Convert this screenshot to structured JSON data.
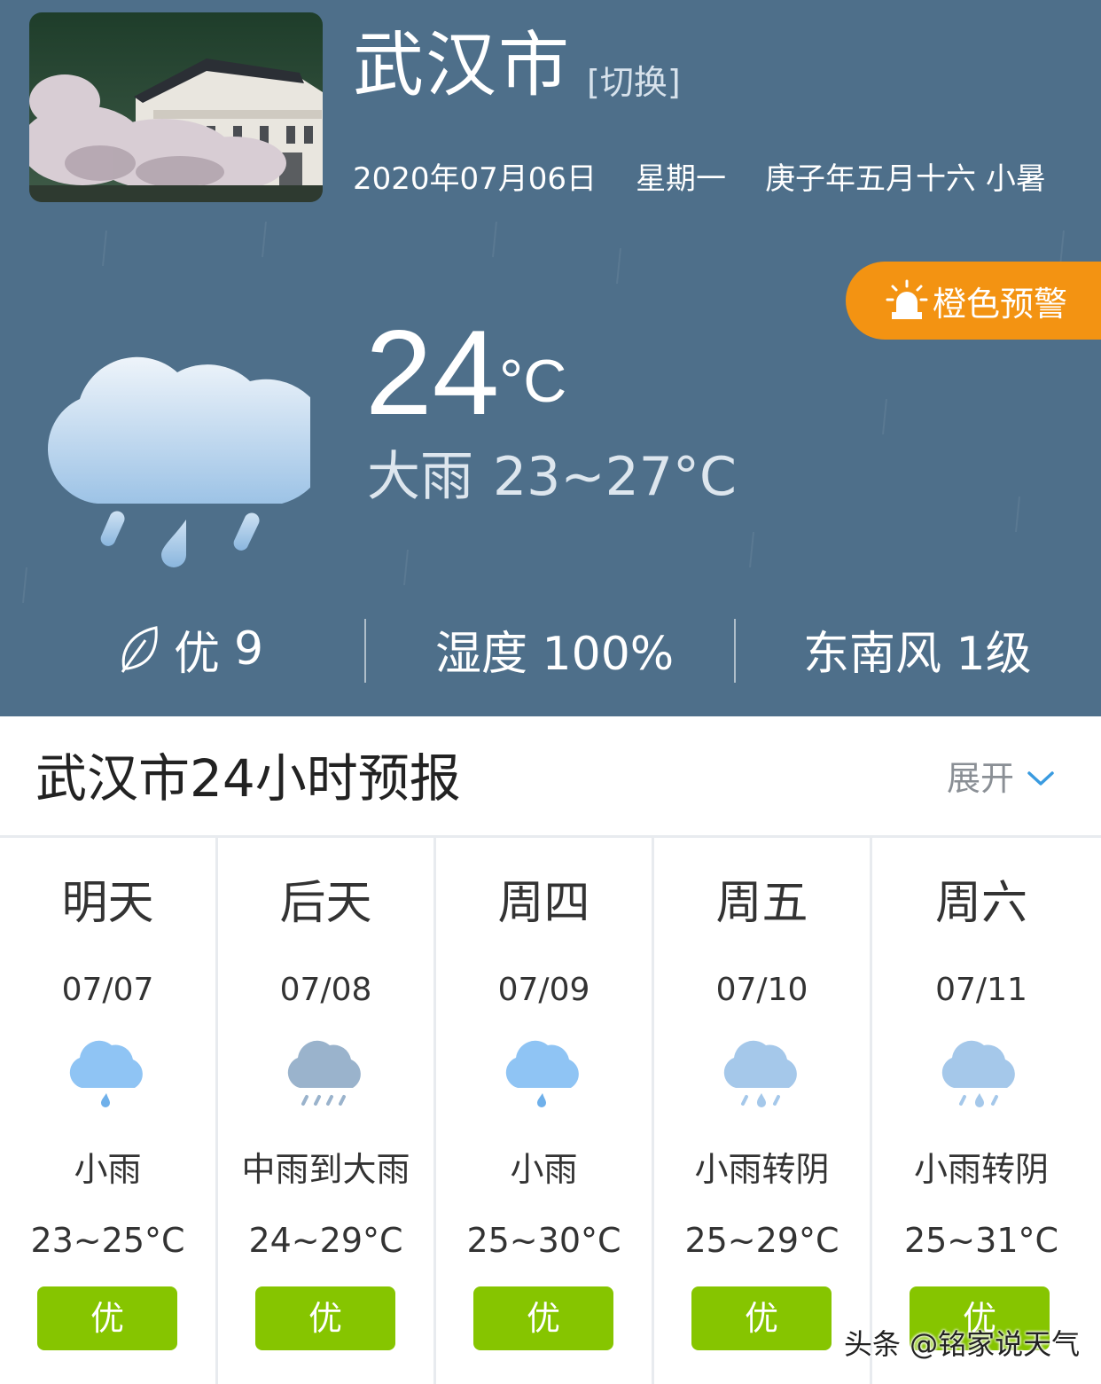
{
  "header": {
    "city": "武汉市",
    "switch_label": "[切换]",
    "date": "2020年07月06日",
    "weekday": "星期一",
    "lunar": "庚子年五月十六 小暑"
  },
  "alert": {
    "label": "橙色预警",
    "color": "#f39312",
    "icon": "siren-icon"
  },
  "current": {
    "temperature": "24",
    "unit": "°C",
    "condition": "大雨",
    "range": "23~27°C",
    "icon": "heavy-rain-icon"
  },
  "stats": {
    "aqi_label": "优",
    "aqi_value": "9",
    "humidity": "湿度 100%",
    "wind": "东南风 1级"
  },
  "forecast_section": {
    "title": "武汉市24小时预报",
    "expand_label": "展开"
  },
  "forecast": [
    {
      "day": "明天",
      "date": "07/07",
      "condition": "小雨",
      "range": "23~25°C",
      "aqi": "优",
      "icon": "light-rain-icon"
    },
    {
      "day": "后天",
      "date": "07/08",
      "condition": "中雨到大雨",
      "range": "24~29°C",
      "aqi": "优",
      "icon": "moderate-heavy-rain-icon"
    },
    {
      "day": "周四",
      "date": "07/09",
      "condition": "小雨",
      "range": "25~30°C",
      "aqi": "优",
      "icon": "light-rain-icon"
    },
    {
      "day": "周五",
      "date": "07/10",
      "condition": "小雨转阴",
      "range": "25~29°C",
      "aqi": "优",
      "icon": "rain-to-overcast-icon"
    },
    {
      "day": "周六",
      "date": "07/11",
      "condition": "小雨转阴",
      "range": "25~31°C",
      "aqi": "优",
      "icon": "rain-to-overcast-icon"
    }
  ],
  "watermark": "头条 @铭家说天气",
  "colors": {
    "hero_bg": "#4e6f8a",
    "aqi_good": "#86c500",
    "alert": "#f39312"
  }
}
